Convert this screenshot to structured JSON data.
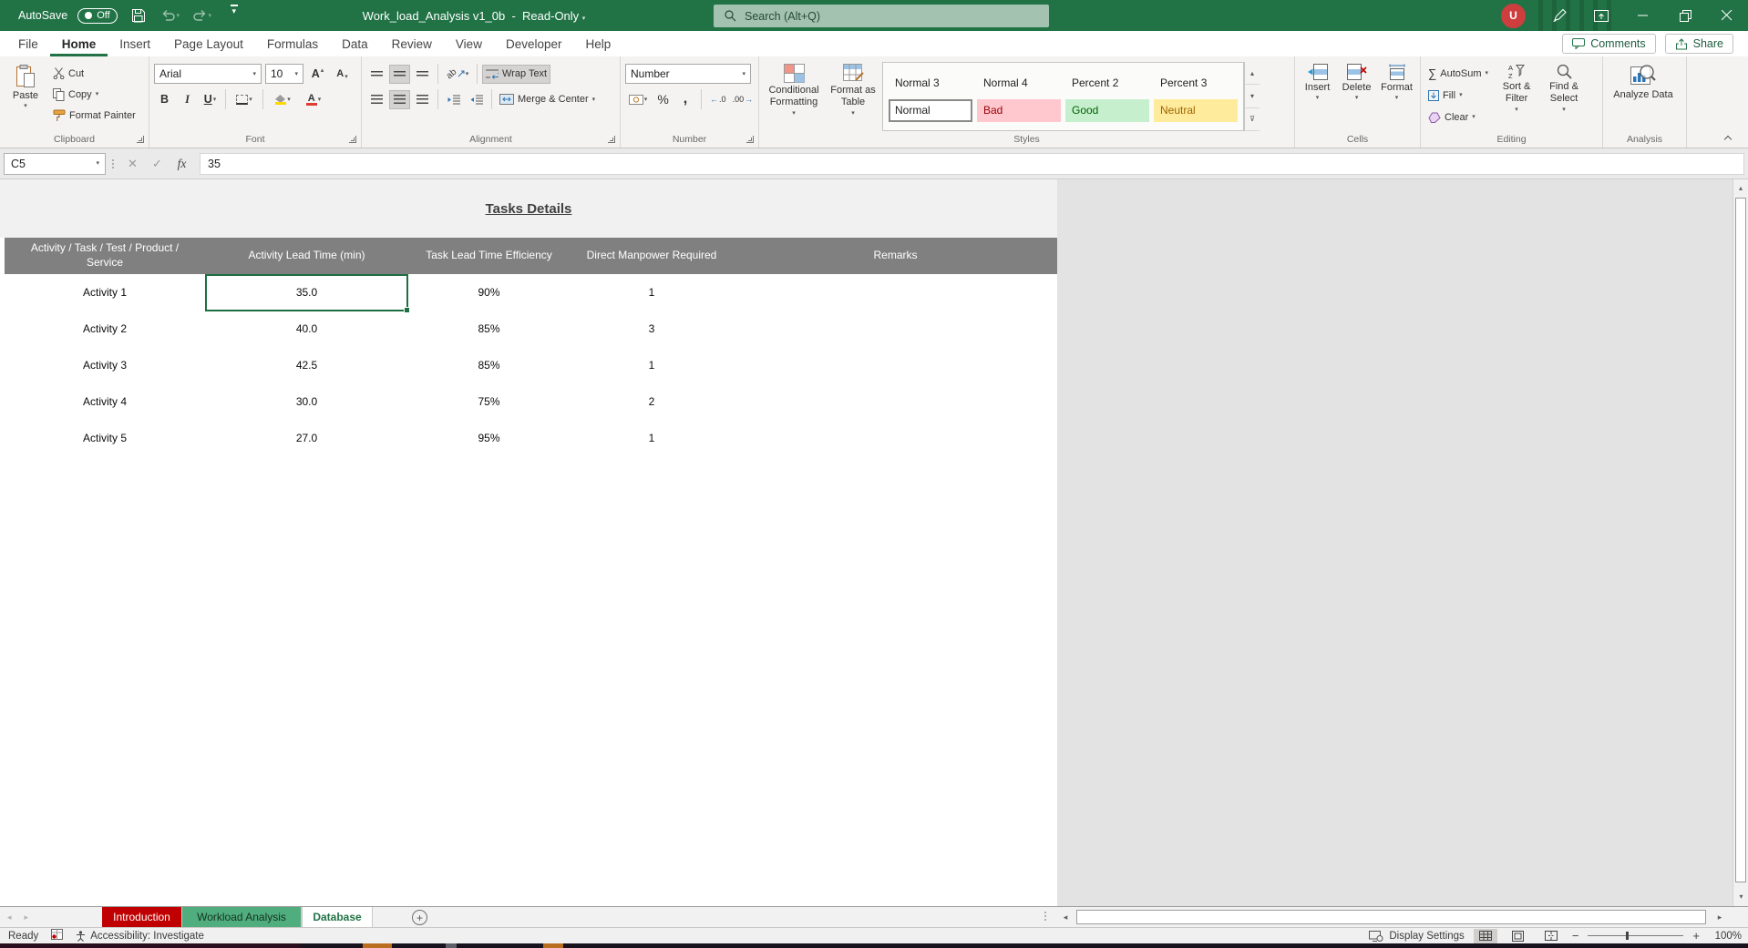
{
  "titlebar": {
    "autosave_label": "AutoSave",
    "autosave_state": "Off",
    "doc_title": "Work_load_Analysis v1_0b",
    "doc_mode": "Read-Only",
    "search_placeholder": "Search (Alt+Q)",
    "avatar_initial": "U"
  },
  "ribbon_tabs": {
    "items": [
      "File",
      "Home",
      "Insert",
      "Page Layout",
      "Formulas",
      "Data",
      "Review",
      "View",
      "Developer",
      "Help"
    ],
    "active": "Home",
    "comments_label": "Comments",
    "share_label": "Share"
  },
  "ribbon": {
    "clipboard": {
      "paste": "Paste",
      "cut": "Cut",
      "copy": "Copy",
      "format_painter": "Format Painter",
      "group_label": "Clipboard"
    },
    "font": {
      "font_name": "Arial",
      "font_size": "10",
      "bold": "B",
      "italic": "I",
      "underline": "U",
      "group_label": "Font"
    },
    "alignment": {
      "wrap_text": "Wrap Text",
      "merge_center": "Merge & Center",
      "group_label": "Alignment"
    },
    "number": {
      "format": "Number",
      "group_label": "Number"
    },
    "styles": {
      "conditional_formatting": "Conditional Formatting",
      "format_as_table": "Format as Table",
      "gallery_top": [
        "Normal 3",
        "Normal 4",
        "Percent 2",
        "Percent 3"
      ],
      "gallery_bottom": [
        "Normal",
        "Bad",
        "Good",
        "Neutral"
      ],
      "group_label": "Styles"
    },
    "cells": {
      "insert": "Insert",
      "delete": "Delete",
      "format": "Format",
      "group_label": "Cells"
    },
    "editing": {
      "autosum": "AutoSum",
      "fill": "Fill",
      "clear": "Clear",
      "sort_filter": "Sort & Filter",
      "find_select": "Find & Select",
      "group_label": "Editing"
    },
    "analysis": {
      "analyze_data": "Analyze Data",
      "group_label": "Analysis"
    }
  },
  "formula_bar": {
    "cell_ref": "C5",
    "value": "35"
  },
  "sheet": {
    "title": "Tasks Details",
    "columns": [
      "Activity / Task / Test / Product / Service",
      "Activity Lead Time (min)",
      "Task Lead Time Efficiency",
      "Direct Manpower Required",
      "Remarks"
    ],
    "rows": [
      {
        "name": "Activity 1",
        "lead_time": "35.0",
        "efficiency": "90%",
        "manpower": "1",
        "remarks": ""
      },
      {
        "name": "Activity 2",
        "lead_time": "40.0",
        "efficiency": "85%",
        "manpower": "3",
        "remarks": ""
      },
      {
        "name": "Activity 3",
        "lead_time": "42.5",
        "efficiency": "85%",
        "manpower": "1",
        "remarks": ""
      },
      {
        "name": "Activity 4",
        "lead_time": "30.0",
        "efficiency": "75%",
        "manpower": "2",
        "remarks": ""
      },
      {
        "name": "Activity 5",
        "lead_time": "27.0",
        "efficiency": "95%",
        "manpower": "1",
        "remarks": ""
      }
    ],
    "selected_cell": "C5"
  },
  "sheet_tabs": {
    "tabs": [
      "Introduction",
      "Workload Analysis",
      "Database"
    ],
    "active": "Database"
  },
  "status_bar": {
    "ready": "Ready",
    "accessibility": "Accessibility: Investigate",
    "display_settings": "Display Settings",
    "zoom_level": "100%"
  }
}
